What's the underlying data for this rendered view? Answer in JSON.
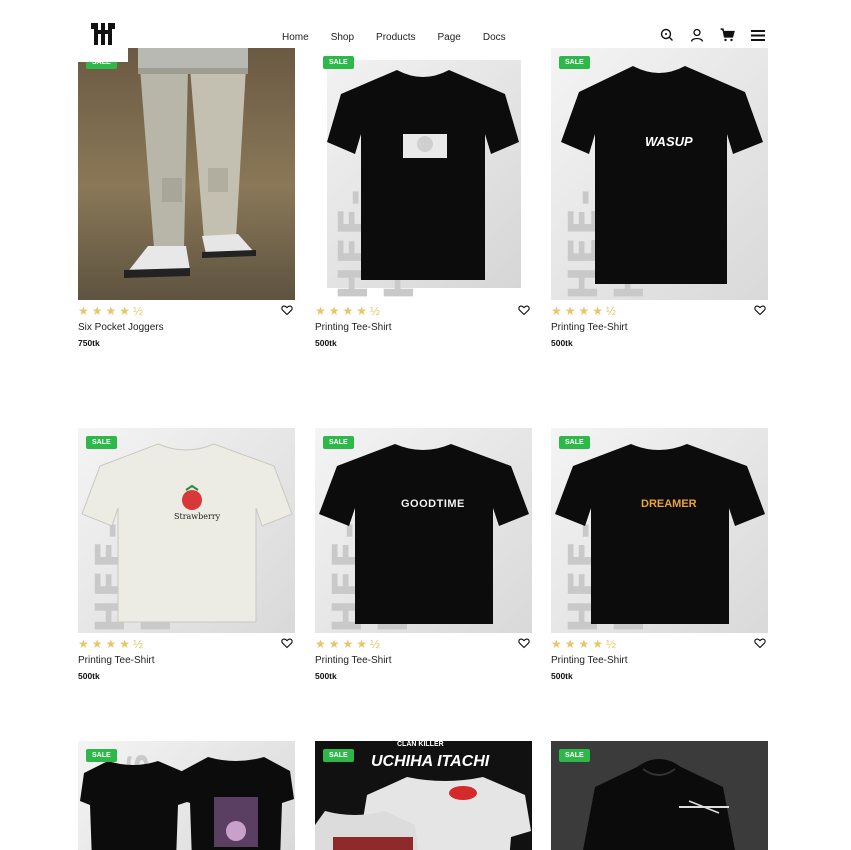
{
  "nav": {
    "items": [
      {
        "label": "Home"
      },
      {
        "label": "Shop"
      },
      {
        "label": "Products"
      },
      {
        "label": "Page"
      },
      {
        "label": "Docs"
      }
    ]
  },
  "header_icons": [
    "search-icon",
    "user-icon",
    "cart-icon",
    "menu-icon"
  ],
  "brand_watermark": "HEE-HEADS",
  "products": [
    {
      "badge": "SALE",
      "name": "Six Pocket Joggers",
      "price": "750tk",
      "rating_display": "★★★★½",
      "image": "joggers-photo"
    },
    {
      "badge": "SALE",
      "name": "Printing Tee-Shirt",
      "price": "500tk",
      "rating_display": "★★★★½",
      "image": "black-tee-anime-print"
    },
    {
      "badge": "SALE",
      "name": "Printing Tee-Shirt",
      "price": "500tk",
      "rating_display": "★★★★½",
      "image": "black-tee-wasup"
    },
    {
      "badge": "SALE",
      "name": "Printing Tee-Shirt",
      "price": "500tk",
      "rating_display": "★★★★½",
      "image": "white-tee-strawberry"
    },
    {
      "badge": "SALE",
      "name": "Printing Tee-Shirt",
      "price": "500tk",
      "rating_display": "★★★★½",
      "image": "black-tee-goodtime"
    },
    {
      "badge": "SALE",
      "name": "Printing Tee-Shirt",
      "price": "500tk",
      "rating_display": "★★★★½",
      "image": "black-tee-dreamer"
    },
    {
      "badge": "SALE",
      "image": "black-tee-front-back"
    },
    {
      "badge": "SALE",
      "image": "uchiha-itachi-tee",
      "print_text": [
        "CLAN KILLER",
        "UCHIHA ITACHI"
      ]
    },
    {
      "badge": "SALE",
      "image": "black-hoodie"
    }
  ],
  "print_texts": {
    "wasup": "WASUP",
    "goodtime": "GOODTIME",
    "dreamer": "DREAMER",
    "strawberry": "Strawberry"
  },
  "colors": {
    "sale_badge": "#2eb84a",
    "stars": "#e7c66b",
    "text": "#222222"
  }
}
